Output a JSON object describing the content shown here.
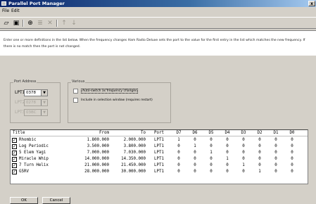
{
  "window": {
    "title": "Parallel Port Manager",
    "close_glyph": "x"
  },
  "menu": {
    "file": "File",
    "edit": "Edit"
  },
  "toolbar": {
    "buttons": [
      {
        "name": "open-icon",
        "glyph": "▱"
      },
      {
        "name": "save-icon",
        "glyph": "▣"
      },
      {
        "name": "new-icon",
        "glyph": "⊕"
      },
      {
        "name": "properties-icon",
        "glyph": "≣"
      },
      {
        "name": "delete-icon",
        "glyph": "✕"
      },
      {
        "name": "move-up-icon",
        "glyph": "↑"
      },
      {
        "name": "move-down-icon",
        "glyph": "↓"
      }
    ]
  },
  "instructions": "Enter one or more definitions in the list below. When the frequency changes Ham Radio Deluxe sets the port to the value for the first entry in the list which matches the new frequency. If there is no match then the port is not changed.",
  "port_address": {
    "legend": "Port Address",
    "ports": [
      {
        "label": "LPT1:",
        "value": "0378",
        "enabled": true
      },
      {
        "label": "LPT2:",
        "value": "0278",
        "enabled": false
      },
      {
        "label": "LPT3:",
        "value": "03BC",
        "enabled": false
      }
    ]
  },
  "various": {
    "legend": "Various",
    "auto_switch": "Auto-switch as frequency changes",
    "include_selection": "Include in selection window (requires restart)"
  },
  "table": {
    "headers": [
      "Title",
      "From",
      "To",
      "Port",
      "D7",
      "D6",
      "D5",
      "D4",
      "D3",
      "D2",
      "D1",
      "D0"
    ],
    "rows": [
      {
        "title": "Rhombic",
        "from": "1.800.000",
        "to": "2.000.000",
        "port": "LPT1",
        "bits": [
          "1",
          "0",
          "0",
          "0",
          "0",
          "0",
          "0",
          "0"
        ],
        "checked": true
      },
      {
        "title": "Log Periodic",
        "from": "3.500.000",
        "to": "3.800.000",
        "port": "LPT1",
        "bits": [
          "0",
          "1",
          "0",
          "0",
          "0",
          "0",
          "0",
          "0"
        ],
        "checked": true
      },
      {
        "title": "5 Elem Yagi",
        "from": "7.000.000",
        "to": "7.030.000",
        "port": "LPT1",
        "bits": [
          "0",
          "0",
          "1",
          "0",
          "0",
          "0",
          "0",
          "0"
        ],
        "checked": true
      },
      {
        "title": "Miracle Whip",
        "from": "14.000.000",
        "to": "14.350.000",
        "port": "LPT1",
        "bits": [
          "0",
          "0",
          "0",
          "1",
          "0",
          "0",
          "0",
          "0"
        ],
        "checked": true
      },
      {
        "title": "7 Turn Helix",
        "from": "21.000.000",
        "to": "21.450.000",
        "port": "LPT1",
        "bits": [
          "0",
          "0",
          "0",
          "0",
          "1",
          "0",
          "0",
          "0"
        ],
        "checked": true
      },
      {
        "title": "G5RV",
        "from": "28.000.000",
        "to": "30.000.000",
        "port": "LPT1",
        "bits": [
          "0",
          "0",
          "0",
          "0",
          "0",
          "1",
          "0",
          "0"
        ],
        "checked": true
      }
    ]
  },
  "buttons": {
    "ok": "OK",
    "cancel": "Cancel"
  }
}
